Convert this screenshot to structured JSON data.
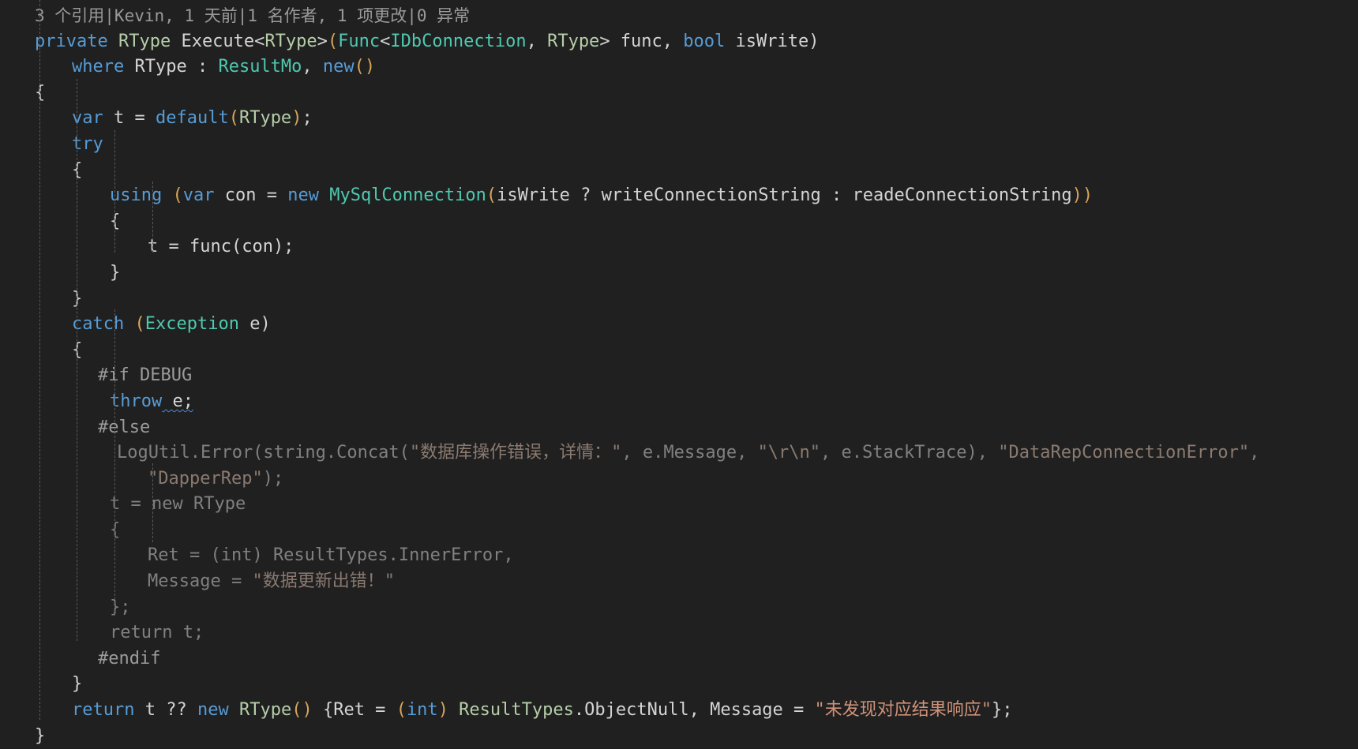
{
  "editor": {
    "background_color": "#202020",
    "font_size_px": 22,
    "line_height_px": 32.6,
    "language": "csharp",
    "file_kind": "code-editor"
  },
  "colors": {
    "keyword": "#569cd6",
    "type": "#b5cea8",
    "class": "#4ec9b0",
    "identifier": "#d4d4d4",
    "string": "#ce9178",
    "inactive": "#808080",
    "inactive_string": "#8a7a70",
    "preprocessor": "#9b9b9b",
    "bracket_level1": "#d7a559",
    "codelens": "#9a9a9a",
    "indent_guide": "#5a5a5a"
  },
  "codelens": {
    "references": "3 个引用",
    "author_changes": "Kevin, 1 天前",
    "authors_edits": "1 名作者, 1 项更改",
    "exceptions": "0 异常",
    "separator": "|",
    "full_text": "3 个引用|Kevin, 1 天前|1 名作者, 1 项更改|0 异常"
  },
  "code": {
    "signature": {
      "t1": "private",
      "t2": " ",
      "t3": "RType",
      "t4": " Execute<",
      "t5": "RType",
      "t6": ">",
      "t7": "(",
      "t8": "Func",
      "t9": "<",
      "t10": "IDbConnection",
      "t11": ", ",
      "t12": "RType",
      "t13": "> func, ",
      "t14": "bool",
      "t15": " isWrite)"
    },
    "where_clause": {
      "kw": "where",
      "rest": " RType : ",
      "type": "ResultMo",
      "tail": ", ",
      "new": "new",
      "parens": "()"
    },
    "open_brace": "{",
    "var_line": {
      "kw": "var",
      "mid": " t = ",
      "def": "default",
      "open": "(",
      "type": "RType",
      "close": ")",
      "semi": ";"
    },
    "try_kw": "try",
    "try_brace": "{",
    "using_line": {
      "kw": "using",
      "open": " (",
      "var": "var",
      "mid": " con = ",
      "new": "new",
      "space": " ",
      "cls": "MySqlConnection",
      "open2": "(",
      "cond": "isWrite ? writeConnectionString : readeConnectionString",
      "close": "))"
    },
    "inner_brace_open": "{",
    "func_call": "t = func(con);",
    "inner_brace_close": "}",
    "try_brace_close": "}",
    "catch_line": {
      "kw": "catch",
      "open": " (",
      "cls": "Exception",
      "rest": " e)"
    },
    "catch_brace": "{",
    "if_debug": "#if DEBUG",
    "throw_line": {
      "kw": "throw",
      "rest": " e;"
    },
    "else_directive": "#else",
    "logutil_line_1": "LogUtil.Error(string.Concat(",
    "logutil_str_1": "\"数据库操作错误，详情：\"",
    "logutil_mid_1": ", e.Message, ",
    "logutil_str_2": "\"\\r\\n\"",
    "logutil_mid_2": ", e.StackTrace), ",
    "logutil_str_3": "\"DataRepConnectionError\"",
    "logutil_trail": ",",
    "logutil_line_2_str": "\"DapperRep\"",
    "logutil_line_2_tail": ");",
    "t_new_rtype": "t = new RType",
    "obj_brace_open": "{",
    "ret_assign": "Ret = (int) ResultTypes.InnerError,",
    "msg_assign_pre": "Message = ",
    "msg_assign_str": "\"数据更新出错！\"",
    "obj_brace_close": "};",
    "return_t": "return t;",
    "endif": "#endif",
    "catch_brace_close": "}",
    "final_return": {
      "kw": "return",
      "mid": " t ?? ",
      "new": "new",
      "space": " ",
      "type": "RType",
      "parens": "()",
      "open": " {",
      "ret": "Ret = ",
      "castopen": "(",
      "int": "int",
      "castclose": ")",
      "resulttypes": " ResultTypes",
      "objnull": ".ObjectNull",
      "msg": ", Message = ",
      "str": "\"未发现对应结果响应\"",
      "close": "};"
    },
    "final_brace": "}"
  }
}
